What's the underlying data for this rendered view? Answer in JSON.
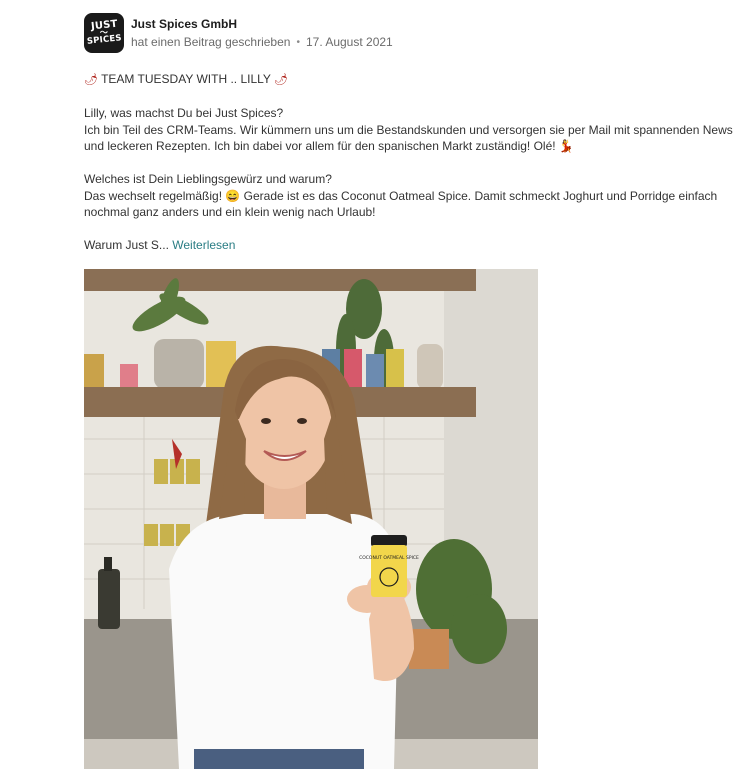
{
  "post": {
    "author": "Just Spices GmbH",
    "logo_line1": "JUST",
    "logo_line2": "SPICES",
    "action": "hat einen Beitrag geschrieben",
    "separator": "•",
    "date": "17. August 2021",
    "title_emoji": "🌶",
    "title": "TEAM TUESDAY WITH .. LILLY",
    "q1": "Lilly, was machst Du bei Just Spices?",
    "a1": "Ich bin Teil des CRM-Teams. Wir kümmern uns um die Bestandskunden und versorgen sie per Mail mit spannenden News und leckeren Rezepten. Ich bin dabei vor allem für den spanischen Markt zuständig! Olé! 💃",
    "q2": "Welches ist Dein Lieblingsgewürz und warum?",
    "a2": "Das wechselt regelmäßig! 😄 Gerade ist es das Coconut Oatmeal Spice. Damit schmeckt Joghurt und Porridge einfach nochmal ganz anders und ein klein wenig nach Urlaub!",
    "truncated": "Warum Just S...",
    "read_more": "Weiterlesen",
    "jar_label": "COCONUT OATMEAL SPICE"
  },
  "colors": {
    "link": "#2a7d84",
    "meta_text": "#6b6b6b",
    "jar_yellow": "#f2d64b"
  }
}
